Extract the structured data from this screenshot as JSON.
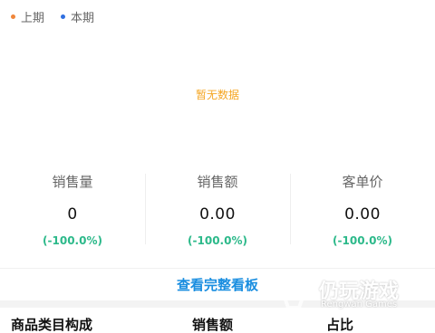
{
  "legend": {
    "items": [
      {
        "label": "上期",
        "color": "#f0863a"
      },
      {
        "label": "本期",
        "color": "#2f6fe0"
      }
    ]
  },
  "empty_state": {
    "text": "暂无数据",
    "color": "#f5a623"
  },
  "metrics": [
    {
      "label": "销售量",
      "value": "0",
      "change": "(-100.0%)"
    },
    {
      "label": "销售额",
      "value": "0.00",
      "change": "(-100.0%)"
    },
    {
      "label": "客单价",
      "value": "0.00",
      "change": "(-100.0%)"
    }
  ],
  "change_color": "#2cb98a",
  "view_link": {
    "label": "查看完整看板",
    "color": "#1a8ee0"
  },
  "table": {
    "columns": [
      "商品类目构成",
      "销售额",
      "占比"
    ]
  },
  "watermark": {
    "title": "仍玩游戏",
    "subtitle": "Rengwan Games"
  }
}
